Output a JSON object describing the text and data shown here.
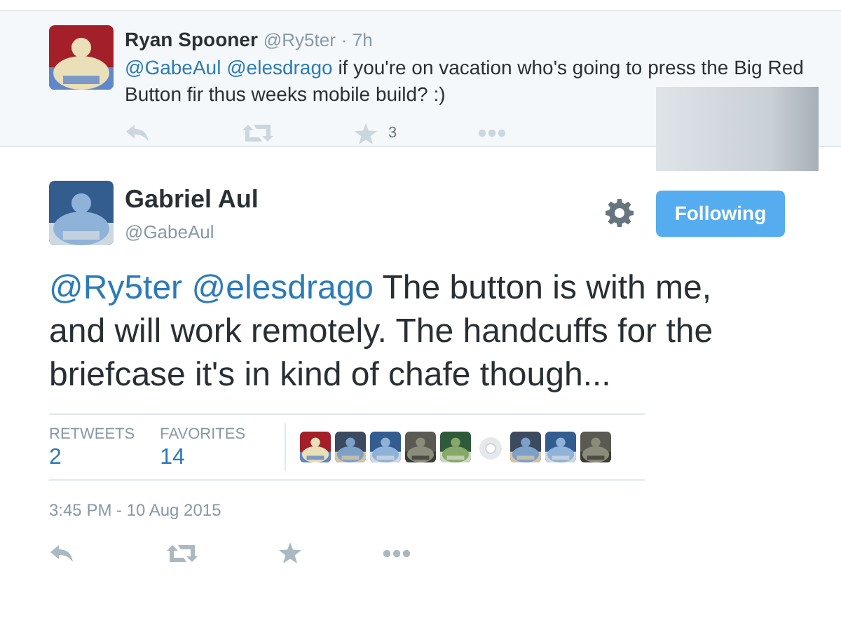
{
  "reply_tweet": {
    "name": "Ryan Spooner",
    "handle": "@Ry5ter",
    "time": "· 7h",
    "text_parts": [
      {
        "kind": "mention",
        "text": "@GabeAul"
      },
      {
        "kind": "mention",
        "text": "@elesdrago"
      },
      {
        "kind": "plain",
        "text": "if you're on vacation who's going to press the Big Red Button fir thus weeks mobile build? :)"
      }
    ],
    "favorite_count": "3"
  },
  "main_tweet": {
    "name": "Gabriel Aul",
    "handle": "@GabeAul",
    "follow_button": "Following",
    "text_parts": [
      {
        "kind": "mention",
        "text": "@Ry5ter"
      },
      {
        "kind": "mention",
        "text": "@elesdrago"
      },
      {
        "kind": "plain",
        "text": "The button is with me, and will work remotely. The handcuffs for the briefcase it's in kind of chafe though..."
      }
    ],
    "stats": [
      {
        "label": "RETWEETS",
        "value": "2"
      },
      {
        "label": "FAVORITES",
        "value": "14"
      }
    ],
    "favoriters": [
      {
        "kind": "picture"
      },
      {
        "kind": "picture"
      },
      {
        "kind": "picture"
      },
      {
        "kind": "picture"
      },
      {
        "kind": "picture"
      },
      {
        "kind": "default"
      },
      {
        "kind": "picture"
      },
      {
        "kind": "picture"
      },
      {
        "kind": "picture"
      }
    ],
    "timestamp": "3:45 PM - 10 Aug 2015"
  }
}
